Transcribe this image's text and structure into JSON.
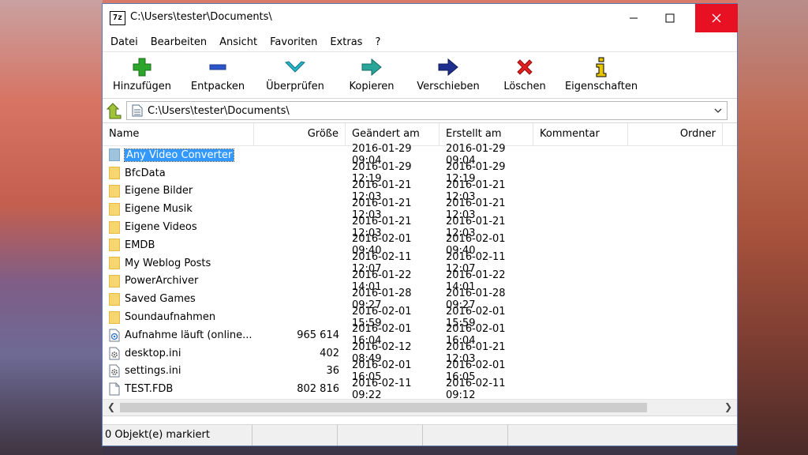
{
  "window": {
    "title": "C:\\Users\\tester\\Documents\\",
    "app_icon_text": "7z"
  },
  "menu": [
    "Datei",
    "Bearbeiten",
    "Ansicht",
    "Favoriten",
    "Extras",
    "?"
  ],
  "toolbar": [
    {
      "label": "Hinzufügen",
      "icon": "add-icon"
    },
    {
      "label": "Entpacken",
      "icon": "extract-icon"
    },
    {
      "label": "Überprüfen",
      "icon": "test-icon"
    },
    {
      "label": "Kopieren",
      "icon": "copy-icon"
    },
    {
      "label": "Verschieben",
      "icon": "move-icon"
    },
    {
      "label": "Löschen",
      "icon": "delete-icon"
    },
    {
      "label": "Eigenschaften",
      "icon": "info-icon"
    }
  ],
  "address": {
    "path": "C:\\Users\\tester\\Documents\\"
  },
  "columns": [
    "Name",
    "Größe",
    "Geändert am",
    "Erstellt am",
    "Kommentar",
    "Ordner"
  ],
  "files": [
    {
      "name": "Any Video Converter",
      "size": "",
      "modified": "2016-01-29 09:04",
      "created": "2016-01-29 09:04",
      "type": "folder",
      "selected": true
    },
    {
      "name": "BfcData",
      "size": "",
      "modified": "2016-01-29 12:19",
      "created": "2016-01-29 12:19",
      "type": "folder"
    },
    {
      "name": "Eigene Bilder",
      "size": "",
      "modified": "2016-01-21 12:03",
      "created": "2016-01-21 12:03",
      "type": "folder"
    },
    {
      "name": "Eigene Musik",
      "size": "",
      "modified": "2016-01-21 12:03",
      "created": "2016-01-21 12:03",
      "type": "folder"
    },
    {
      "name": "Eigene Videos",
      "size": "",
      "modified": "2016-01-21 12:03",
      "created": "2016-01-21 12:03",
      "type": "folder"
    },
    {
      "name": "EMDB",
      "size": "",
      "modified": "2016-02-01 09:40",
      "created": "2016-02-01 09:40",
      "type": "folder"
    },
    {
      "name": "My Weblog Posts",
      "size": "",
      "modified": "2016-02-11 12:07",
      "created": "2016-02-11 12:07",
      "type": "folder"
    },
    {
      "name": "PowerArchiver",
      "size": "",
      "modified": "2016-01-22 14:01",
      "created": "2016-01-22 14:01",
      "type": "folder"
    },
    {
      "name": "Saved Games",
      "size": "",
      "modified": "2016-01-28 09:27",
      "created": "2016-01-28 09:27",
      "type": "folder"
    },
    {
      "name": "Soundaufnahmen",
      "size": "",
      "modified": "2016-02-01 15:59",
      "created": "2016-02-01 15:59",
      "type": "folder"
    },
    {
      "name": "Aufnahme läuft (online...",
      "size": "965 614",
      "modified": "2016-02-01 16:04",
      "created": "2016-02-01 16:04",
      "type": "media"
    },
    {
      "name": "desktop.ini",
      "size": "402",
      "modified": "2016-02-12 08:49",
      "created": "2016-01-21 12:03",
      "type": "settings"
    },
    {
      "name": "settings.ini",
      "size": "36",
      "modified": "2016-02-01 16:05",
      "created": "2016-02-01 16:05",
      "type": "settings"
    },
    {
      "name": "TEST.FDB",
      "size": "802 816",
      "modified": "2016-02-11 09:22",
      "created": "2016-02-11 09:12",
      "type": "file"
    }
  ],
  "status": {
    "selected": "0 Objekt(e) markiert"
  },
  "colors": {
    "folder": "#f8d66f",
    "selection": "#3399ff",
    "close": "#e81123"
  }
}
